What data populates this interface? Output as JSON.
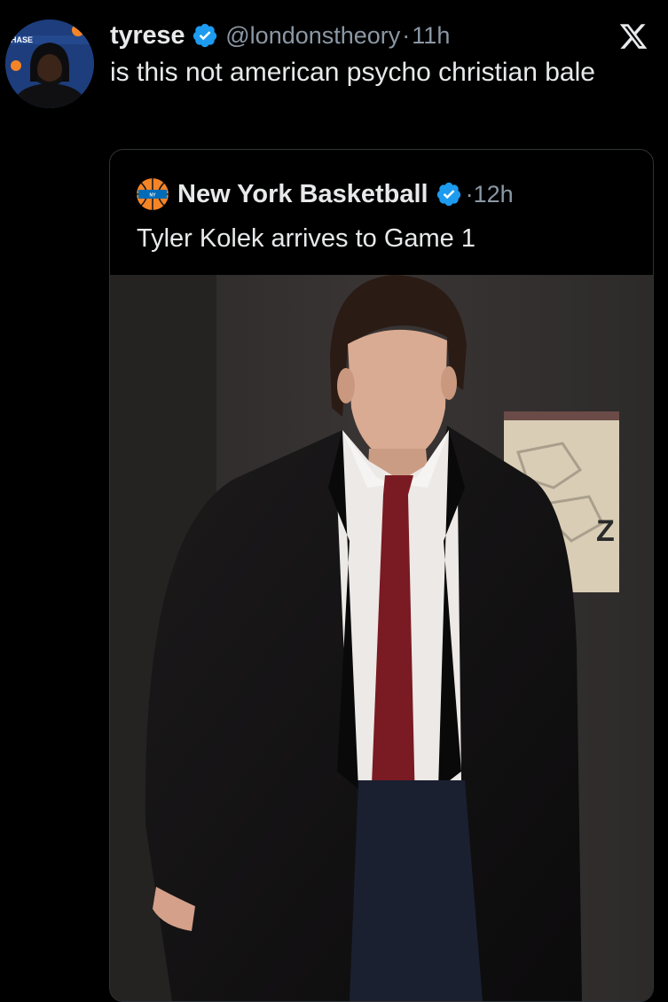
{
  "tweet": {
    "author_name": "tyrese",
    "handle": "@londonstheory",
    "separator": "·",
    "time": "11h",
    "text": "is this not american psycho christian bale",
    "avatar": {
      "icon": "profile-photo",
      "sponsor_text": "HASE"
    }
  },
  "quoted": {
    "author_name": "New York Basketball",
    "separator": "·",
    "time": "12h",
    "text": "Tyler Kolek arrives to Game 1",
    "logo_icon": "knicks-basketball-logo",
    "media": {
      "icon": "photo-man-in-black-suit-red-tie",
      "wall_sign_letter": "Z"
    }
  },
  "app": {
    "logo_icon": "x-logo"
  },
  "colors": {
    "background": "#000000",
    "text": "#e7e9ea",
    "secondary": "#8b98a5",
    "verified": "#1d9bf0",
    "border": "#2f3336",
    "knicks_orange": "#f58426",
    "knicks_blue": "#006bb6",
    "tie": "#7a1a22"
  }
}
